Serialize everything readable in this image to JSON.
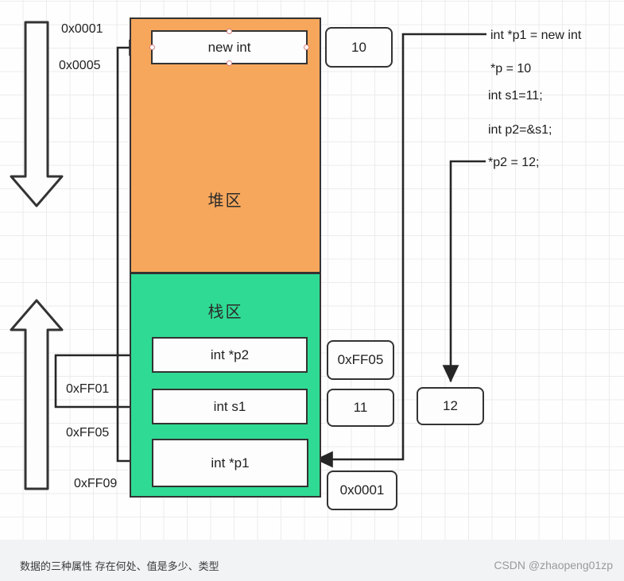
{
  "canvas": {
    "grid": true,
    "background": "#fefefe",
    "grid_color": "#ececec"
  },
  "regions": {
    "heap": {
      "label": "堆区",
      "fill": "#f6a75c",
      "stroke": "#333333"
    },
    "stack": {
      "label": "栈区",
      "fill": "#2fdb94",
      "stroke": "#333333"
    }
  },
  "cells": {
    "new_int": "new int",
    "p2": "int *p2",
    "s1": "int s1",
    "p1": "int *p1"
  },
  "value_boxes": {
    "heap_value": "10",
    "p2_value": "0xFF05",
    "s1_value": "11",
    "p1_value": "0x0001",
    "updated_value": "12"
  },
  "addresses": {
    "heap_start": "0x0001",
    "heap_second": "0x0005",
    "stack_ff01": "0xFF01",
    "stack_ff05": "0xFF05",
    "stack_ff09": "0xFF09"
  },
  "code_lines": [
    "int *p1 = new int",
    "*p = 10",
    "int s1=11;",
    "int p2=&s1;",
    "*p2 = 12;"
  ],
  "arrows": {
    "heap_direction_icon": "down-arrow-icon",
    "stack_direction_icon": "up-arrow-icon"
  },
  "footer": {
    "note": "数据的三种属性  存在何处、值是多少、类型",
    "credit": "CSDN @zhaopeng01zp"
  }
}
